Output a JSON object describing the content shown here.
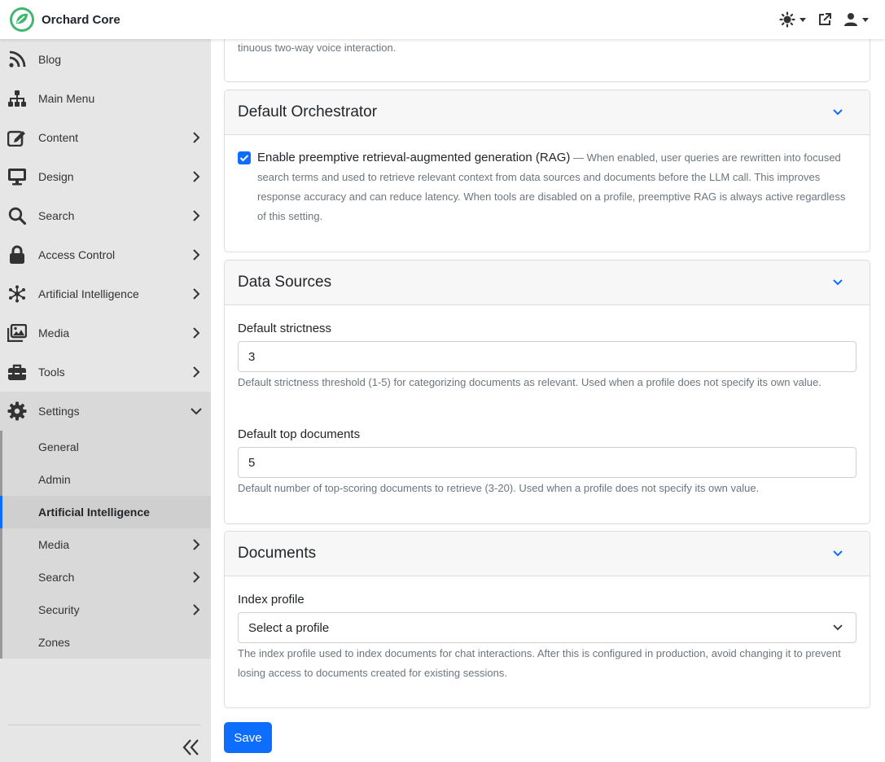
{
  "app": {
    "brand_name": "Orchard Core",
    "accent_color": "#0d6efd",
    "logo_color": "#41b670"
  },
  "topbar": {
    "icons": [
      "theme-toggle-icon",
      "external-link-icon",
      "user-icon"
    ]
  },
  "sidebar": {
    "items": [
      {
        "label": "Blog",
        "icon": "rss-icon",
        "has_children": false
      },
      {
        "label": "Main Menu",
        "icon": "sitemap-icon",
        "has_children": false
      },
      {
        "label": "Content",
        "icon": "edit-icon",
        "has_children": true
      },
      {
        "label": "Design",
        "icon": "monitor-icon",
        "has_children": true
      },
      {
        "label": "Search",
        "icon": "search-icon",
        "has_children": true
      },
      {
        "label": "Access Control",
        "icon": "lock-icon",
        "has_children": true
      },
      {
        "label": "Artificial Intelligence",
        "icon": "network-icon",
        "has_children": true
      },
      {
        "label": "Media",
        "icon": "images-icon",
        "has_children": true
      },
      {
        "label": "Tools",
        "icon": "toolbox-icon",
        "has_children": true
      },
      {
        "label": "Settings",
        "icon": "gear-icon",
        "has_children": true,
        "expanded": true
      }
    ],
    "settings_children": [
      {
        "label": "General",
        "has_children": false
      },
      {
        "label": "Admin",
        "has_children": false
      },
      {
        "label": "Artificial Intelligence",
        "has_children": false,
        "selected": true
      },
      {
        "label": "Media",
        "has_children": true
      },
      {
        "label": "Search",
        "has_children": true
      },
      {
        "label": "Security",
        "has_children": true
      },
      {
        "label": "Zones",
        "has_children": false
      }
    ]
  },
  "main": {
    "top_card_text": "tinuous two-way voice interaction.",
    "orchestrator": {
      "title": "Default Orchestrator",
      "checkbox_checked": true,
      "checkbox_label": "Enable preemptive retrieval-augmented generation (RAG)",
      "checkbox_help": " — When enabled, user queries are rewritten into focused search terms and used to retrieve relevant context from data sources and documents before the LLM call. This improves response accuracy and can reduce latency. When tools are disabled on a profile, preemptive RAG is always active regardless of this setting."
    },
    "data_sources": {
      "title": "Data Sources",
      "strictness_label": "Default strictness",
      "strictness_value": "3",
      "strictness_help": "Default strictness threshold (1-5) for categorizing documents as relevant. Used when a profile does not specify its own value.",
      "top_docs_label": "Default top documents",
      "top_docs_value": "5",
      "top_docs_help": "Default number of top-scoring documents to retrieve (3-20). Used when a profile does not specify its own value."
    },
    "documents": {
      "title": "Documents",
      "index_profile_label": "Index profile",
      "index_profile_value": "Select a profile",
      "index_profile_help": "The index profile used to index documents for chat interactions. After this is configured in production, avoid changing it to prevent losing access to documents created for existing sessions."
    },
    "save_label": "Save"
  }
}
